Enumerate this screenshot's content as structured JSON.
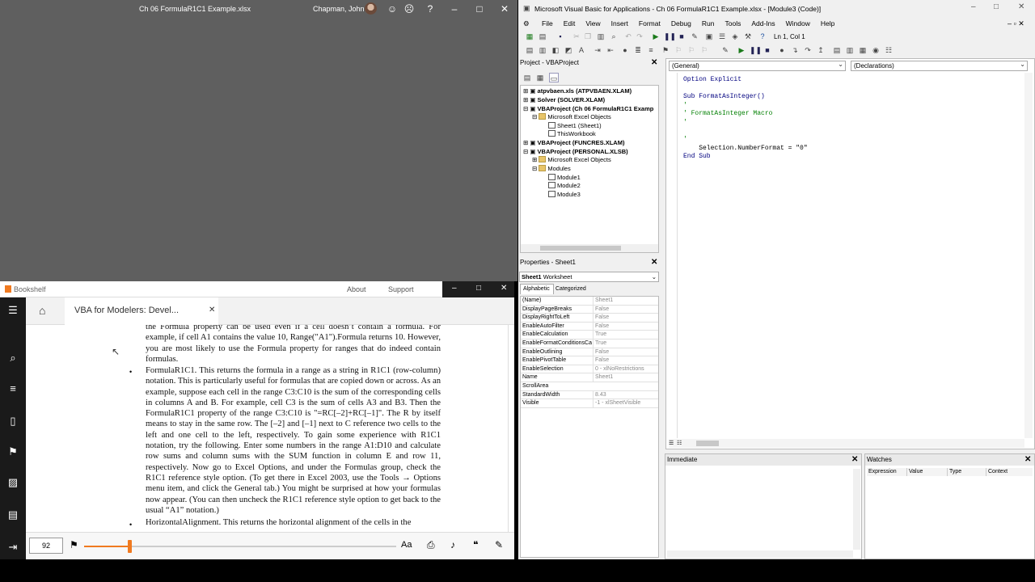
{
  "excel": {
    "title": "Ch 06 FormulaR1C1 Example.xlsx",
    "user": "Chapman, John"
  },
  "bookshelf": {
    "app": "Bookshelf",
    "about": "About",
    "support": "Support",
    "tab_title": "VBA for Modelers: Devel...",
    "page": "92",
    "p1": "the Formula property can be used even if a cell doesn’t contain a formula. For example, if cell A1 contains the value 10, Range(\"A1\").Formula returns 10. However, you are most likely to use the Formula property for ranges that do indeed contain formulas.",
    "p2": "FormulaR1C1. This returns the formula in a range as a string in R1C1 (row-column) notation. This is particularly useful for formulas that are copied down or across. As an example, suppose each cell in the range C3:C10 is the sum of the corresponding cells in columns A and B. For example, cell C3 is the sum of cells A3 and B3. Then the FormulaR1C1 property of the range C3:C10 is \"=RC[–2]+RC[–1]\". The R by itself means to stay in the same row. The [–2] and [–1] next to C reference two cells to the left and one cell to the left, respectively. To gain some experience with R1C1 notation, try the following. Enter some numbers in the range A1:D10 and calculate row sums and column sums with the SUM function in column E and row 11, respectively. Now go to Excel Options, and under the Formulas group, check the R1C1 reference style option. (To get there in Excel 2003, use the Tools → Options menu item, and click the General tab.) You might be surprised at how your formulas now appear. (You can then uncheck the R1C1 reference style option to get back to the usual “A1” notation.)",
    "p3": "HorizontalAlignment. This returns the horizontal alignment of the cells in the"
  },
  "vba": {
    "title": "Microsoft Visual Basic for Applications - Ch 06 FormulaR1C1 Example.xlsx - [Module3 (Code)]",
    "menu": [
      "File",
      "Edit",
      "View",
      "Insert",
      "Format",
      "Debug",
      "Run",
      "Tools",
      "Add-Ins",
      "Window",
      "Help"
    ],
    "position": "Ln 1, Col 1",
    "project_title": "Project - VBAProject",
    "tree": [
      "atpvbaen.xls (ATPVBAEN.XLAM)",
      "Solver (SOLVER.XLAM)",
      "VBAProject (Ch 06 FormulaR1C1 Examp",
      "Microsoft Excel Objects",
      "Sheet1 (Sheet1)",
      "ThisWorkbook",
      "VBAProject (FUNCRES.XLAM)",
      "VBAProject (PERSONAL.XLSB)",
      "Microsoft Excel Objects",
      "Modules",
      "Module1",
      "Module2",
      "Module3"
    ],
    "props_title": "Properties - Sheet1",
    "props_object": "Sheet1",
    "props_type": "Worksheet",
    "tab_alpha": "Alphabetic",
    "tab_cat": "Categorized",
    "props": [
      [
        "(Name)",
        "Sheet1"
      ],
      [
        "DisplayPageBreaks",
        "False"
      ],
      [
        "DisplayRightToLeft",
        "False"
      ],
      [
        "EnableAutoFilter",
        "False"
      ],
      [
        "EnableCalculation",
        "True"
      ],
      [
        "EnableFormatConditionsCa",
        "True"
      ],
      [
        "EnableOutlining",
        "False"
      ],
      [
        "EnablePivotTable",
        "False"
      ],
      [
        "EnableSelection",
        "0 - xlNoRestrictions"
      ],
      [
        "Name",
        "Sheet1"
      ],
      [
        "ScrollArea",
        ""
      ],
      [
        "StandardWidth",
        "8.43"
      ],
      [
        "Visible",
        "-1 - xlSheetVisible"
      ]
    ],
    "combo_left": "(General)",
    "combo_right": "(Declarations)",
    "code": [
      "Option Explicit",
      "",
      "Sub FormatAsInteger()",
      "'",
      "' FormatAsInteger Macro",
      "'",
      "",
      "'",
      "    Selection.NumberFormat = \"0\"",
      "End Sub"
    ],
    "immediate": "Immediate",
    "watches": "Watches",
    "watch_cols": [
      "Expression",
      "Value",
      "Type",
      "Context"
    ]
  }
}
